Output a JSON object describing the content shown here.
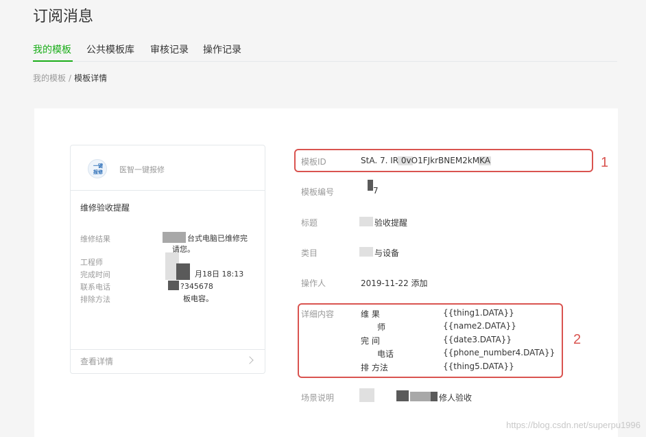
{
  "page": {
    "title": "订阅消息"
  },
  "tabs": [
    {
      "label": "我的模板",
      "active": true
    },
    {
      "label": "公共模板库",
      "active": false
    },
    {
      "label": "审核记录",
      "active": false
    },
    {
      "label": "操作记录",
      "active": false
    }
  ],
  "breadcrumb": {
    "parent": "我的模板",
    "separator": "/",
    "current": "模板详情"
  },
  "preview": {
    "app_name": "医智一键报修",
    "avatar_line1": "一键",
    "avatar_line2": "报修",
    "title": "维修验收提醒",
    "rows": [
      {
        "label": "维修结果",
        "value_line1": "台式电脑已维修完",
        "value_line2": "请您。"
      },
      {
        "label": "工程师",
        "value": ""
      },
      {
        "label": "完成时间",
        "value": "月18日 18:13"
      },
      {
        "label": "联系电话",
        "value": "?345678"
      },
      {
        "label": "排除方法",
        "value": "板电容。"
      }
    ],
    "footer_label": "查看详情"
  },
  "details": {
    "template_id": {
      "label": "模板ID",
      "value": "StA.        7.                    IR        0vO1FJkrBNEM2kMKA"
    },
    "template_no": {
      "label": "模板编号",
      "value": "7"
    },
    "title": {
      "label": "标题",
      "value": "验收提醒"
    },
    "category": {
      "label": "类目",
      "value": "与设备"
    },
    "operator": {
      "label": "操作人",
      "value": "2019-11-22 添加"
    },
    "content": {
      "label": "详细内容",
      "fields": [
        {
          "name": "维    果",
          "token": "{{thing1.DATA}}"
        },
        {
          "name": "师",
          "token": "{{name2.DATA}}"
        },
        {
          "name": "完    间",
          "token": "{{date3.DATA}}"
        },
        {
          "name": "电话",
          "token": "{{phone_number4.DATA}}"
        },
        {
          "name": "排    方法",
          "token": "{{thing5.DATA}}"
        }
      ]
    },
    "scene": {
      "label": "场景说明",
      "value": "修人验收"
    }
  },
  "annotations": {
    "box1_number": "1",
    "box2_number": "2"
  },
  "watermark": "https://blog.csdn.net/superpu1996"
}
